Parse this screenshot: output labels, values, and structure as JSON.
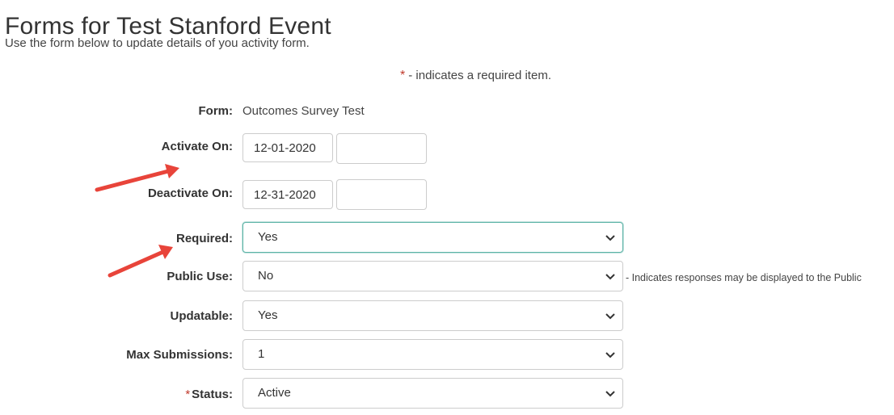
{
  "page": {
    "title": "Forms for Test Stanford Event",
    "subtitle": "Use the form below to update details of you activity form.",
    "required_note_star": "*",
    "required_note": "- indicates a required item."
  },
  "form": {
    "form_label": "Form:",
    "form_value": "Outcomes Survey Test",
    "activate_label": "Activate On:",
    "activate_date": "12-01-2020",
    "activate_time": "",
    "deactivate_label": "Deactivate On:",
    "deactivate_date": "12-31-2020",
    "deactivate_time": "",
    "required_label": "Required:",
    "required_value": "Yes",
    "public_use_label": "Public Use:",
    "public_use_value": "No",
    "public_use_hint": "- Indicates responses may be displayed to the Public",
    "updatable_label": "Updatable:",
    "updatable_value": "Yes",
    "max_submissions_label": "Max Submissions:",
    "max_submissions_value": "1",
    "status_star": "*",
    "status_label": "Status:",
    "status_value": "Active"
  },
  "icons": {
    "chevron": "chevron-down-icon",
    "annotation_arrow": "red-arrow-annotation"
  },
  "colors": {
    "required_star": "#c0392b",
    "focus_border": "#5cb3a6",
    "annotation_arrow": "#e8443a"
  }
}
